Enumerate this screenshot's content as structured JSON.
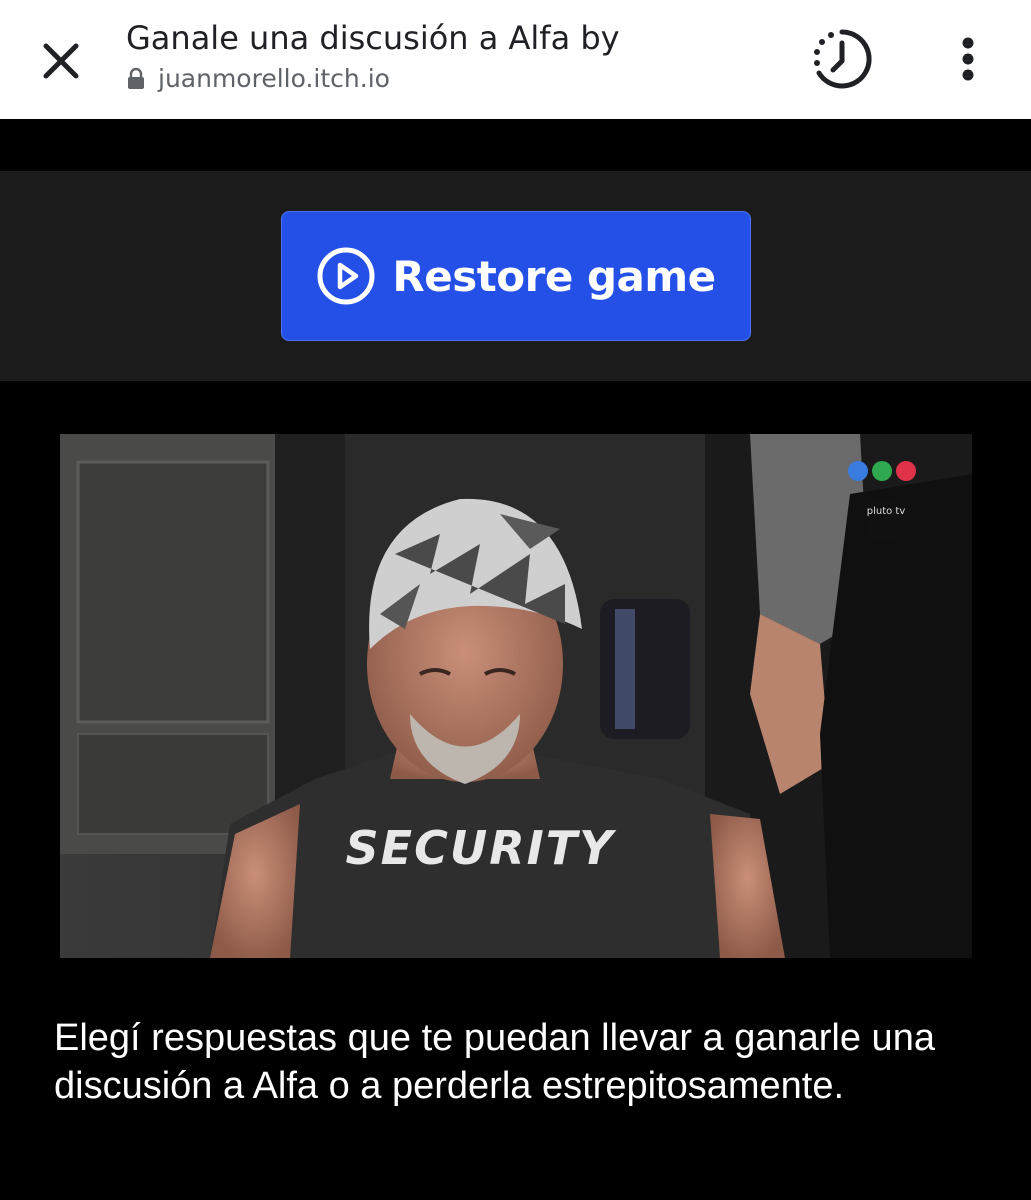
{
  "browser": {
    "title": "Ganale una discusión a Alfa by",
    "url": "juanmorello.itch.io",
    "icons": {
      "close": "close-icon",
      "lock": "lock-icon",
      "history": "history-timer-icon",
      "menu": "more-vert-icon"
    }
  },
  "game": {
    "restore_label": "Restore game",
    "restore_icon": "play-circle-icon",
    "accent_color": "#2450e8",
    "image_text": {
      "shirt": "SECURITY",
      "channel": "pluto tv"
    },
    "caption": "Elegí respuestas que te puedan llevar a ganarle una discusión a Alfa o a perderla estrepitosamente."
  }
}
